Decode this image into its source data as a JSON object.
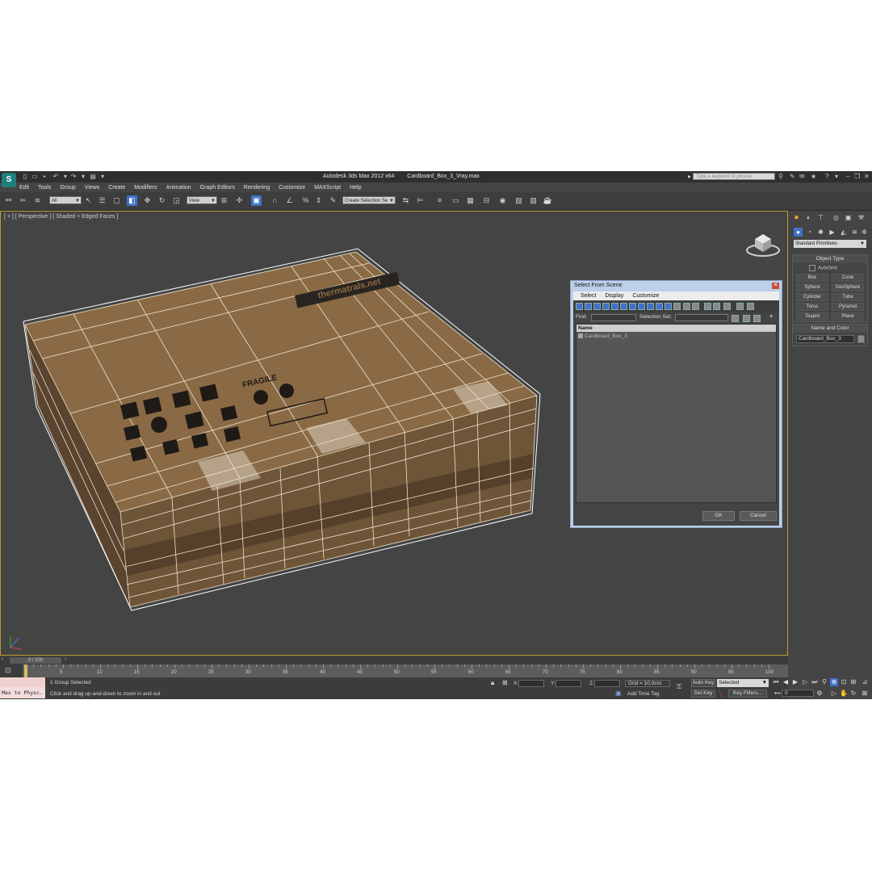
{
  "window": {
    "app_title": "Autodesk 3ds Max  2012 x64",
    "file_name": "Cardboard_Box_3_Vray.max",
    "search_placeholder": "Type a keyword or phrase",
    "logo_letter": "S"
  },
  "menubar": [
    "Edit",
    "Tools",
    "Group",
    "Views",
    "Create",
    "Modifiers",
    "Animation",
    "Graph Editors",
    "Rendering",
    "Customize",
    "MAXScript",
    "Help"
  ],
  "toolbar": {
    "selection_filter": "All",
    "reference_coord": "View",
    "named_selection": "Create Selection Se"
  },
  "viewport": {
    "label": "[ + ] [ Perspective ] [ Shaded + Edged Faces ]",
    "box_label_brand": "thermatrals.net",
    "box_label_fragile": "FRAGILE"
  },
  "dialog": {
    "title": "Select From Scene",
    "menu": [
      "Select",
      "Display",
      "Customize"
    ],
    "find_label": "Find:",
    "selection_set_label": "Selection Set:",
    "column_name": "Name",
    "items": [
      "Cardboard_Box_3"
    ],
    "ok": "OK",
    "cancel": "Cancel"
  },
  "command_panel": {
    "category": "Standard Primitives",
    "object_type_title": "Object Type",
    "autogrid_label": "AutoGrid",
    "primitives": [
      "Box",
      "Cone",
      "Sphere",
      "GeoSphere",
      "Cylinder",
      "Tube",
      "Torus",
      "Pyramid",
      "Teapot",
      "Plane"
    ],
    "name_color_title": "Name and Color",
    "object_name": "Cardboard_Box_3"
  },
  "timeline": {
    "frame_display": "0 / 100",
    "ticks": [
      "5",
      "10",
      "15",
      "20",
      "25",
      "30",
      "35",
      "40",
      "45",
      "50",
      "55",
      "60",
      "65",
      "70",
      "75",
      "80",
      "85",
      "90",
      "95",
      "100"
    ]
  },
  "status": {
    "maxscript_listener": "Max to Physc.",
    "selection": "1 Group Selected",
    "prompt": "Click and drag up-and-down to zoom in and out",
    "x_label": "X:",
    "y_label": "Y:",
    "z_label": "Z:",
    "grid": "Grid = 10,0cm",
    "add_time_tag": "Add Time Tag",
    "auto_key": "Auto Key",
    "set_key": "Set Key",
    "key_mode": "Selected",
    "key_filters": "Key Filters...",
    "current_frame": "0"
  },
  "colors": {
    "accent_blue": "#3f72c8",
    "viewport_bg": "#444444",
    "viewport_border": "#b99b30",
    "box_tan": "#8a6a45"
  }
}
